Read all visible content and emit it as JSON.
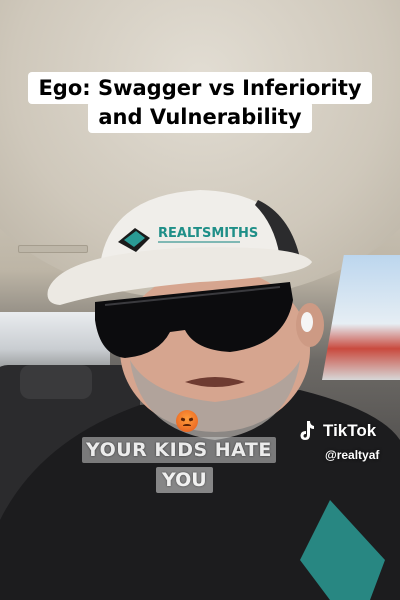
{
  "video": {
    "title_line_1": "Ego: Swagger vs Inferiority",
    "title_line_2": "and Vulnerability",
    "hat_text": "REALTSMITHS",
    "caption_line_1": "YOUR KIDS HATE",
    "caption_line_2": "YOU",
    "emoji": "angry-face-emoji"
  },
  "watermark": {
    "brand": "TikTok",
    "handle": "@realtyaf"
  },
  "colors": {
    "title_bg": "#ffffff",
    "title_text": "#000000",
    "caption_text": "#ececec",
    "hat_accent": "#1f8f88"
  }
}
